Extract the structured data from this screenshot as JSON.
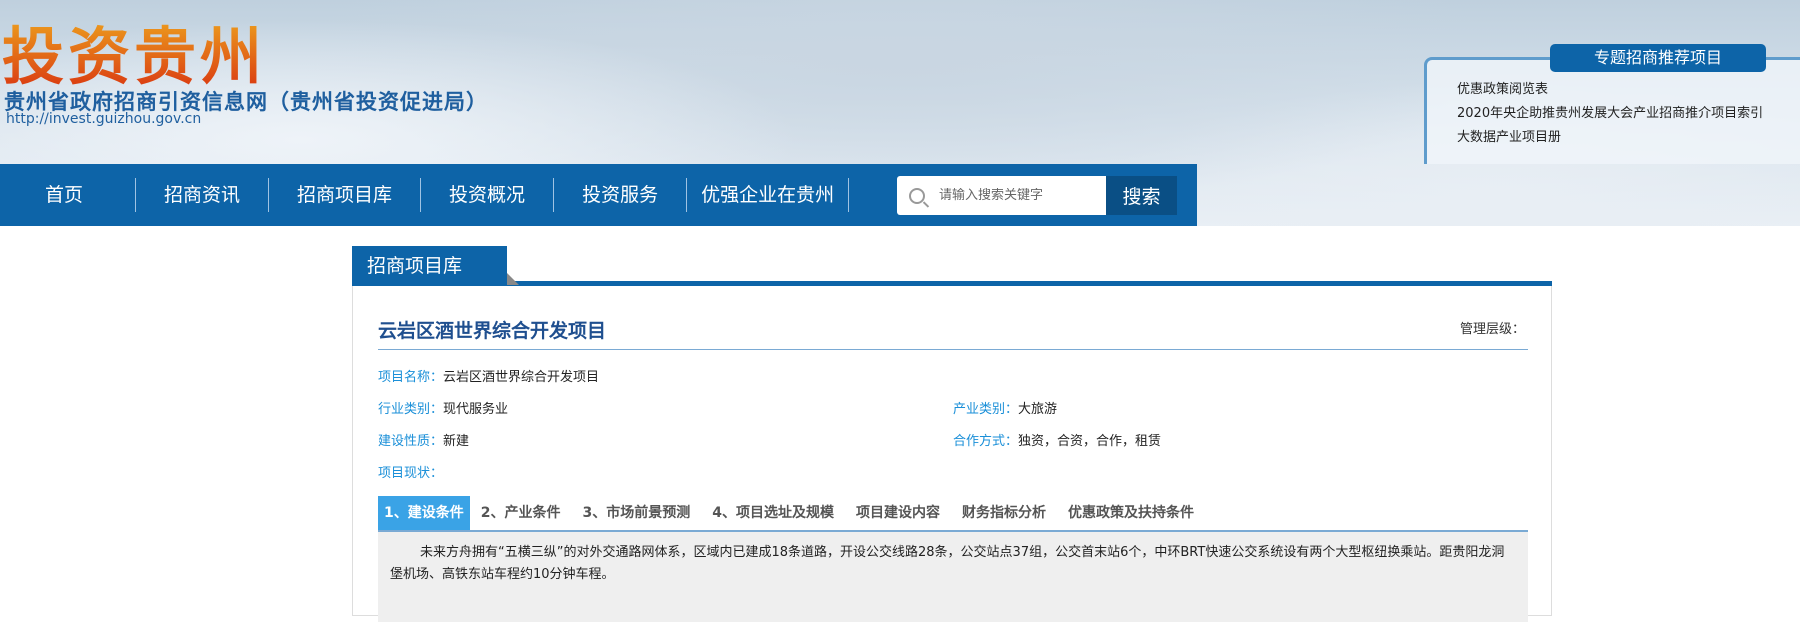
{
  "header": {
    "logo": "投资贵州",
    "subtitle": "贵州省政府招商引资信息网（贵州省投资促进局）",
    "url": "http://invest.guizhou.gov.cn"
  },
  "nav": {
    "items": [
      "首页",
      "招商资讯",
      "招商项目库",
      "投资概况",
      "投资服务",
      "优强企业在贵州"
    ],
    "search_placeholder": "请输入搜索关键字",
    "search_label": "搜索"
  },
  "recommend": {
    "title": "专题招商推荐项目",
    "items": [
      "优惠政策阅览表",
      "2020年央企助推贵州发展大会产业招商推介项目索引",
      "大数据产业项目册"
    ]
  },
  "panel": {
    "tab": "招商项目库",
    "title": "云岩区酒世界综合开发项目",
    "level_label": "管理层级：",
    "fields": {
      "name_k": "项目名称：",
      "name_v": "云岩区酒世界综合开发项目",
      "industry_k": "行业类别：",
      "industry_v": "现代服务业",
      "sector_k": "产业类别：",
      "sector_v": "大旅游",
      "nature_k": "建设性质：",
      "nature_v": "新建",
      "coop_k": "合作方式：",
      "coop_v": "独资，合资，合作，租赁",
      "status_k": "项目现状："
    },
    "tabs": [
      "1、建设条件",
      "2、产业条件",
      "3、市场前景预测",
      "4、项目选址及规模",
      "项目建设内容",
      "财务指标分析",
      "优惠政策及扶持条件"
    ],
    "content": "未来方舟拥有“五横三纵”的对外交通路网体系，区域内已建成18条道路，开设公交线路28条，公交站点37组，公交首末站6个，中环BRT快速公交系统设有两个大型枢纽换乘站。距贵阳龙洞堡机场、高铁东站车程约10分钟车程。"
  }
}
